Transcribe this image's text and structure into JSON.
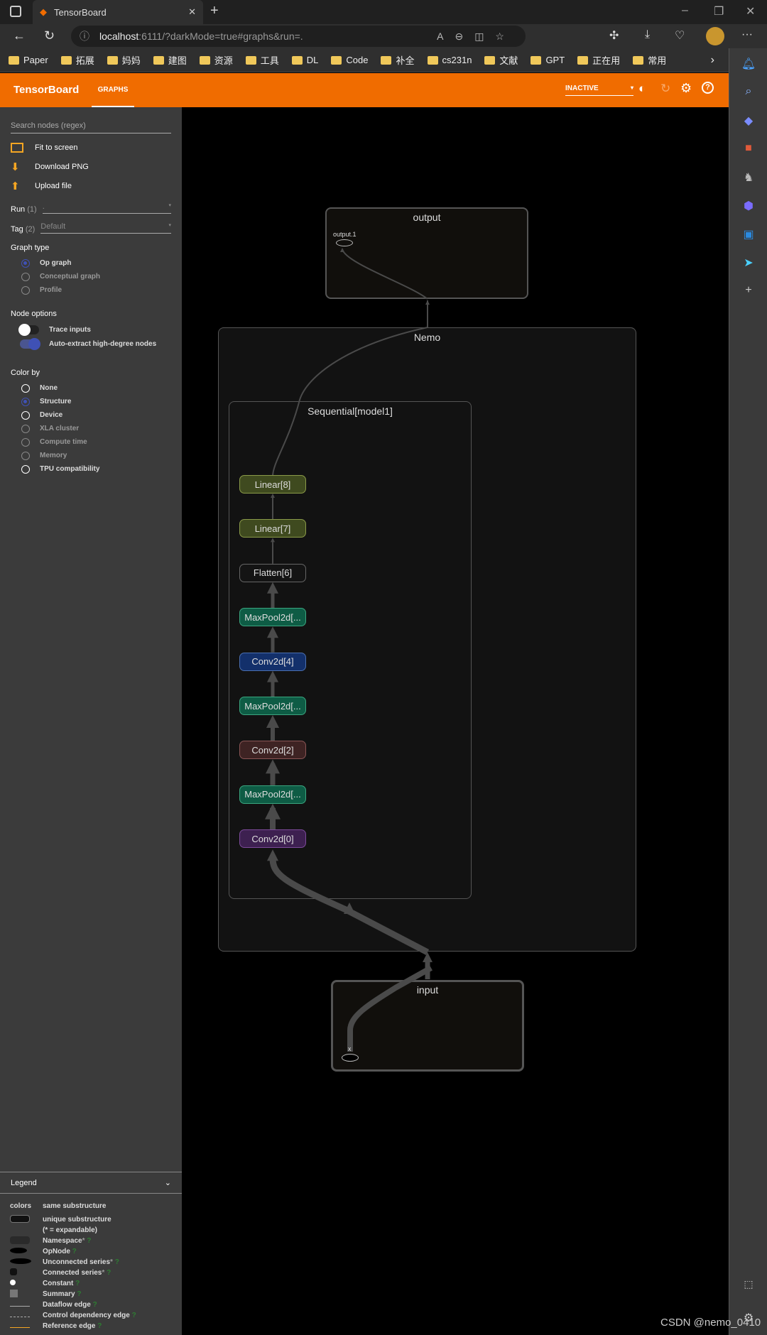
{
  "browser": {
    "tab_title": "TensorBoard",
    "url_host": "localhost",
    "url_rest": ":6111/?darkMode=true#graphs&run=.",
    "bookmarks": [
      "Paper",
      "拓展",
      "妈妈",
      "建图",
      "资源",
      "工具",
      "DL",
      "Code",
      "补全",
      "cs231n",
      "文献",
      "GPT",
      "正在用",
      "常用"
    ]
  },
  "header": {
    "brand": "TensorBoard",
    "tab": "GRAPHS",
    "status": "INACTIVE",
    "accent": "#f06c00"
  },
  "sidebar": {
    "search_placeholder": "Search nodes (regex)",
    "fit": "Fit to screen",
    "download": "Download PNG",
    "upload": "Upload file",
    "run_label": "Run",
    "run_count": "(1)",
    "run_value": ".",
    "tag_label": "Tag",
    "tag_count": "(2)",
    "tag_value": "Default",
    "graph_type_title": "Graph type",
    "graph_types": [
      "Op graph",
      "Conceptual graph",
      "Profile"
    ],
    "node_options_title": "Node options",
    "trace_inputs": "Trace inputs",
    "auto_extract": "Auto-extract high-degree nodes",
    "color_by_title": "Color by",
    "color_by": [
      "None",
      "Structure",
      "Device",
      "XLA cluster",
      "Compute time",
      "Memory",
      "TPU compatibility"
    ]
  },
  "legend": {
    "title": "Legend",
    "colors": "colors",
    "same": "same substructure",
    "unique": "unique substructure",
    "expandable": "(* = expandable)",
    "items": [
      "Namespace",
      "OpNode",
      "Unconnected series",
      "Connected series",
      "Constant",
      "Summary",
      "Dataflow edge",
      "Control dependency edge",
      "Reference edge"
    ],
    "q": "?",
    "star": "*"
  },
  "graph": {
    "output": "output",
    "output_node": "output.1",
    "nemo": "Nemo",
    "sequential": "Sequential[model1]",
    "input": "input",
    "input_node": "x",
    "nodes": [
      "Linear[8]",
      "Linear[7]",
      "Flatten[6]",
      "MaxPool2d[...",
      "Conv2d[4]",
      "MaxPool2d[...",
      "Conv2d[2]",
      "MaxPool2d[...",
      "Conv2d[0]"
    ]
  },
  "watermark": "CSDN @nemo_0410"
}
